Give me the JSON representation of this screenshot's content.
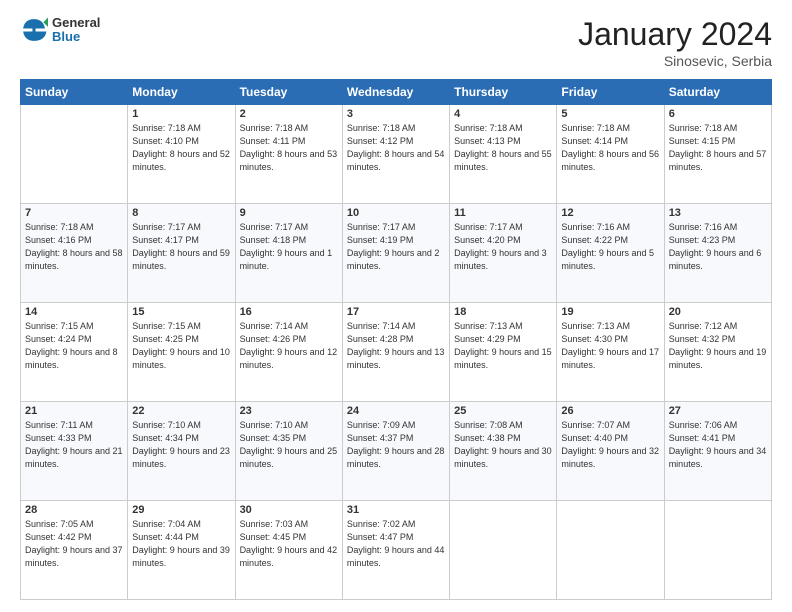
{
  "header": {
    "logo_general": "General",
    "logo_blue": "Blue",
    "month_title": "January 2024",
    "subtitle": "Sinosevic, Serbia"
  },
  "weekdays": [
    "Sunday",
    "Monday",
    "Tuesday",
    "Wednesday",
    "Thursday",
    "Friday",
    "Saturday"
  ],
  "weeks": [
    [
      {
        "day": "",
        "sunrise": "",
        "sunset": "",
        "daylight": ""
      },
      {
        "day": "1",
        "sunrise": "Sunrise: 7:18 AM",
        "sunset": "Sunset: 4:10 PM",
        "daylight": "Daylight: 8 hours and 52 minutes."
      },
      {
        "day": "2",
        "sunrise": "Sunrise: 7:18 AM",
        "sunset": "Sunset: 4:11 PM",
        "daylight": "Daylight: 8 hours and 53 minutes."
      },
      {
        "day": "3",
        "sunrise": "Sunrise: 7:18 AM",
        "sunset": "Sunset: 4:12 PM",
        "daylight": "Daylight: 8 hours and 54 minutes."
      },
      {
        "day": "4",
        "sunrise": "Sunrise: 7:18 AM",
        "sunset": "Sunset: 4:13 PM",
        "daylight": "Daylight: 8 hours and 55 minutes."
      },
      {
        "day": "5",
        "sunrise": "Sunrise: 7:18 AM",
        "sunset": "Sunset: 4:14 PM",
        "daylight": "Daylight: 8 hours and 56 minutes."
      },
      {
        "day": "6",
        "sunrise": "Sunrise: 7:18 AM",
        "sunset": "Sunset: 4:15 PM",
        "daylight": "Daylight: 8 hours and 57 minutes."
      }
    ],
    [
      {
        "day": "7",
        "sunrise": "Sunrise: 7:18 AM",
        "sunset": "Sunset: 4:16 PM",
        "daylight": "Daylight: 8 hours and 58 minutes."
      },
      {
        "day": "8",
        "sunrise": "Sunrise: 7:17 AM",
        "sunset": "Sunset: 4:17 PM",
        "daylight": "Daylight: 8 hours and 59 minutes."
      },
      {
        "day": "9",
        "sunrise": "Sunrise: 7:17 AM",
        "sunset": "Sunset: 4:18 PM",
        "daylight": "Daylight: 9 hours and 1 minute."
      },
      {
        "day": "10",
        "sunrise": "Sunrise: 7:17 AM",
        "sunset": "Sunset: 4:19 PM",
        "daylight": "Daylight: 9 hours and 2 minutes."
      },
      {
        "day": "11",
        "sunrise": "Sunrise: 7:17 AM",
        "sunset": "Sunset: 4:20 PM",
        "daylight": "Daylight: 9 hours and 3 minutes."
      },
      {
        "day": "12",
        "sunrise": "Sunrise: 7:16 AM",
        "sunset": "Sunset: 4:22 PM",
        "daylight": "Daylight: 9 hours and 5 minutes."
      },
      {
        "day": "13",
        "sunrise": "Sunrise: 7:16 AM",
        "sunset": "Sunset: 4:23 PM",
        "daylight": "Daylight: 9 hours and 6 minutes."
      }
    ],
    [
      {
        "day": "14",
        "sunrise": "Sunrise: 7:15 AM",
        "sunset": "Sunset: 4:24 PM",
        "daylight": "Daylight: 9 hours and 8 minutes."
      },
      {
        "day": "15",
        "sunrise": "Sunrise: 7:15 AM",
        "sunset": "Sunset: 4:25 PM",
        "daylight": "Daylight: 9 hours and 10 minutes."
      },
      {
        "day": "16",
        "sunrise": "Sunrise: 7:14 AM",
        "sunset": "Sunset: 4:26 PM",
        "daylight": "Daylight: 9 hours and 12 minutes."
      },
      {
        "day": "17",
        "sunrise": "Sunrise: 7:14 AM",
        "sunset": "Sunset: 4:28 PM",
        "daylight": "Daylight: 9 hours and 13 minutes."
      },
      {
        "day": "18",
        "sunrise": "Sunrise: 7:13 AM",
        "sunset": "Sunset: 4:29 PM",
        "daylight": "Daylight: 9 hours and 15 minutes."
      },
      {
        "day": "19",
        "sunrise": "Sunrise: 7:13 AM",
        "sunset": "Sunset: 4:30 PM",
        "daylight": "Daylight: 9 hours and 17 minutes."
      },
      {
        "day": "20",
        "sunrise": "Sunrise: 7:12 AM",
        "sunset": "Sunset: 4:32 PM",
        "daylight": "Daylight: 9 hours and 19 minutes."
      }
    ],
    [
      {
        "day": "21",
        "sunrise": "Sunrise: 7:11 AM",
        "sunset": "Sunset: 4:33 PM",
        "daylight": "Daylight: 9 hours and 21 minutes."
      },
      {
        "day": "22",
        "sunrise": "Sunrise: 7:10 AM",
        "sunset": "Sunset: 4:34 PM",
        "daylight": "Daylight: 9 hours and 23 minutes."
      },
      {
        "day": "23",
        "sunrise": "Sunrise: 7:10 AM",
        "sunset": "Sunset: 4:35 PM",
        "daylight": "Daylight: 9 hours and 25 minutes."
      },
      {
        "day": "24",
        "sunrise": "Sunrise: 7:09 AM",
        "sunset": "Sunset: 4:37 PM",
        "daylight": "Daylight: 9 hours and 28 minutes."
      },
      {
        "day": "25",
        "sunrise": "Sunrise: 7:08 AM",
        "sunset": "Sunset: 4:38 PM",
        "daylight": "Daylight: 9 hours and 30 minutes."
      },
      {
        "day": "26",
        "sunrise": "Sunrise: 7:07 AM",
        "sunset": "Sunset: 4:40 PM",
        "daylight": "Daylight: 9 hours and 32 minutes."
      },
      {
        "day": "27",
        "sunrise": "Sunrise: 7:06 AM",
        "sunset": "Sunset: 4:41 PM",
        "daylight": "Daylight: 9 hours and 34 minutes."
      }
    ],
    [
      {
        "day": "28",
        "sunrise": "Sunrise: 7:05 AM",
        "sunset": "Sunset: 4:42 PM",
        "daylight": "Daylight: 9 hours and 37 minutes."
      },
      {
        "day": "29",
        "sunrise": "Sunrise: 7:04 AM",
        "sunset": "Sunset: 4:44 PM",
        "daylight": "Daylight: 9 hours and 39 minutes."
      },
      {
        "day": "30",
        "sunrise": "Sunrise: 7:03 AM",
        "sunset": "Sunset: 4:45 PM",
        "daylight": "Daylight: 9 hours and 42 minutes."
      },
      {
        "day": "31",
        "sunrise": "Sunrise: 7:02 AM",
        "sunset": "Sunset: 4:47 PM",
        "daylight": "Daylight: 9 hours and 44 minutes."
      },
      {
        "day": "",
        "sunrise": "",
        "sunset": "",
        "daylight": ""
      },
      {
        "day": "",
        "sunrise": "",
        "sunset": "",
        "daylight": ""
      },
      {
        "day": "",
        "sunrise": "",
        "sunset": "",
        "daylight": ""
      }
    ]
  ]
}
